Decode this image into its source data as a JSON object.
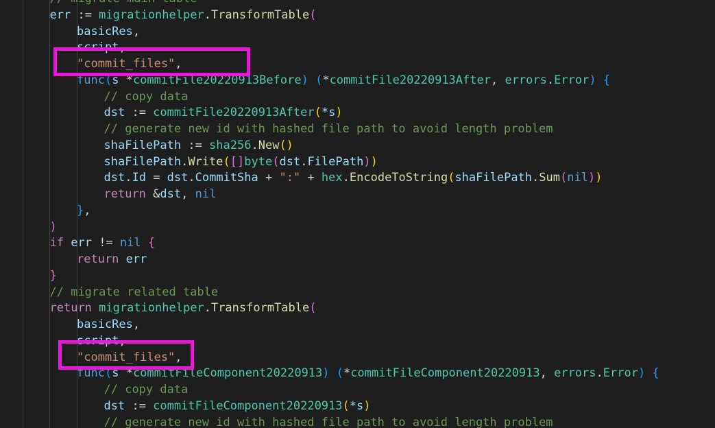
{
  "colors": {
    "background": "#1e1e1e",
    "highlight": "#e817d9",
    "keyword": "#569cd6",
    "control": "#c586c0",
    "identifier": "#9cdcfe",
    "function": "#dcdcaa",
    "type": "#4ec9b0",
    "string": "#ce9178",
    "comment": "#6a9955",
    "plain": "#d4d4d4",
    "bracket1": "#ffd700",
    "bracket2": "#da70d6",
    "bracket3": "#179fff"
  },
  "lines": [
    {
      "indent": 1,
      "tokens": [
        [
          "// migrate main table",
          "comment"
        ]
      ]
    },
    {
      "indent": 1,
      "tokens": [
        [
          "err",
          "identifier"
        ],
        [
          " := ",
          "plain"
        ],
        [
          "migrationhelper",
          "type"
        ],
        [
          ".",
          "plain"
        ],
        [
          "TransformTable",
          "function"
        ],
        [
          "(",
          "bracket2"
        ]
      ]
    },
    {
      "indent": 2,
      "tokens": [
        [
          "basicRes",
          "identifier"
        ],
        [
          ",",
          "plain"
        ]
      ]
    },
    {
      "indent": 2,
      "tokens": [
        [
          "script",
          "identifier"
        ],
        [
          ",",
          "plain"
        ]
      ]
    },
    {
      "indent": 2,
      "tokens": [
        [
          "\"commit_files\"",
          "string"
        ],
        [
          ",",
          "plain"
        ]
      ]
    },
    {
      "indent": 2,
      "tokens": [
        [
          "func",
          "keyword"
        ],
        [
          "(",
          "bracket3"
        ],
        [
          "s ",
          "identifier"
        ],
        [
          "*",
          "plain"
        ],
        [
          "commitFile20220913Before",
          "type"
        ],
        [
          ") ",
          "bracket3"
        ],
        [
          "(",
          "bracket3"
        ],
        [
          "*",
          "plain"
        ],
        [
          "commitFile20220913After",
          "type"
        ],
        [
          ", ",
          "plain"
        ],
        [
          "errors",
          "type"
        ],
        [
          ".",
          "plain"
        ],
        [
          "Error",
          "type"
        ],
        [
          ") ",
          "bracket3"
        ],
        [
          "{",
          "bracket3"
        ]
      ]
    },
    {
      "indent": 3,
      "tokens": [
        [
          "// copy data",
          "comment"
        ]
      ]
    },
    {
      "indent": 3,
      "tokens": [
        [
          "dst",
          "identifier"
        ],
        [
          " := ",
          "plain"
        ],
        [
          "commitFile20220913After",
          "type"
        ],
        [
          "(",
          "bracket1"
        ],
        [
          "*s",
          "identifier"
        ],
        [
          ")",
          "bracket1"
        ]
      ]
    },
    {
      "indent": 3,
      "tokens": [
        [
          "// generate new id with hashed file path to avoid length problem",
          "comment"
        ]
      ]
    },
    {
      "indent": 3,
      "tokens": [
        [
          "shaFilePath",
          "identifier"
        ],
        [
          " := ",
          "plain"
        ],
        [
          "sha256",
          "type"
        ],
        [
          ".",
          "plain"
        ],
        [
          "New",
          "function"
        ],
        [
          "()",
          "bracket1"
        ]
      ]
    },
    {
      "indent": 3,
      "tokens": [
        [
          "shaFilePath",
          "identifier"
        ],
        [
          ".",
          "plain"
        ],
        [
          "Write",
          "function"
        ],
        [
          "(",
          "bracket1"
        ],
        [
          "[]",
          "bracket2"
        ],
        [
          "byte",
          "type"
        ],
        [
          "(",
          "bracket2"
        ],
        [
          "dst",
          "identifier"
        ],
        [
          ".",
          "plain"
        ],
        [
          "FilePath",
          "identifier"
        ],
        [
          ")",
          "bracket2"
        ],
        [
          ")",
          "bracket1"
        ]
      ]
    },
    {
      "indent": 3,
      "tokens": [
        [
          "dst",
          "identifier"
        ],
        [
          ".",
          "plain"
        ],
        [
          "Id",
          "identifier"
        ],
        [
          " = ",
          "plain"
        ],
        [
          "dst",
          "identifier"
        ],
        [
          ".",
          "plain"
        ],
        [
          "CommitSha",
          "identifier"
        ],
        [
          " + ",
          "plain"
        ],
        [
          "\":\"",
          "string"
        ],
        [
          " + ",
          "plain"
        ],
        [
          "hex",
          "type"
        ],
        [
          ".",
          "plain"
        ],
        [
          "EncodeToString",
          "function"
        ],
        [
          "(",
          "bracket1"
        ],
        [
          "shaFilePath",
          "identifier"
        ],
        [
          ".",
          "plain"
        ],
        [
          "Sum",
          "function"
        ],
        [
          "(",
          "bracket2"
        ],
        [
          "nil",
          "keyword"
        ],
        [
          ")",
          "bracket2"
        ],
        [
          ")",
          "bracket1"
        ]
      ]
    },
    {
      "indent": 3,
      "tokens": [
        [
          "return",
          "control"
        ],
        [
          " &",
          "plain"
        ],
        [
          "dst",
          "identifier"
        ],
        [
          ", ",
          "plain"
        ],
        [
          "nil",
          "keyword"
        ]
      ]
    },
    {
      "indent": 2,
      "tokens": [
        [
          "}",
          "bracket3"
        ],
        [
          ",",
          "plain"
        ]
      ]
    },
    {
      "indent": 1,
      "tokens": [
        [
          ")",
          "bracket2"
        ]
      ]
    },
    {
      "indent": 1,
      "tokens": [
        [
          "if",
          "control"
        ],
        [
          " ",
          "plain"
        ],
        [
          "err",
          "identifier"
        ],
        [
          " != ",
          "plain"
        ],
        [
          "nil",
          "keyword"
        ],
        [
          " ",
          "plain"
        ],
        [
          "{",
          "bracket2"
        ]
      ]
    },
    {
      "indent": 2,
      "tokens": [
        [
          "return",
          "control"
        ],
        [
          " ",
          "plain"
        ],
        [
          "err",
          "identifier"
        ]
      ]
    },
    {
      "indent": 1,
      "tokens": [
        [
          "}",
          "bracket2"
        ]
      ]
    },
    {
      "indent": 1,
      "tokens": [
        [
          "// migrate related table",
          "comment"
        ]
      ]
    },
    {
      "indent": 1,
      "tokens": [
        [
          "return",
          "control"
        ],
        [
          " ",
          "plain"
        ],
        [
          "migrationhelper",
          "type"
        ],
        [
          ".",
          "plain"
        ],
        [
          "TransformTable",
          "function"
        ],
        [
          "(",
          "bracket2"
        ]
      ]
    },
    {
      "indent": 2,
      "tokens": [
        [
          "basicRes",
          "identifier"
        ],
        [
          ",",
          "plain"
        ]
      ]
    },
    {
      "indent": 2,
      "tokens": [
        [
          "script",
          "identifier"
        ],
        [
          ",",
          "plain"
        ]
      ]
    },
    {
      "indent": 2,
      "tokens": [
        [
          "\"commit_files\"",
          "string"
        ],
        [
          ",",
          "plain"
        ]
      ]
    },
    {
      "indent": 2,
      "tokens": [
        [
          "func",
          "keyword"
        ],
        [
          "(",
          "bracket3"
        ],
        [
          "s ",
          "identifier"
        ],
        [
          "*",
          "plain"
        ],
        [
          "commitFileComponent20220913",
          "type"
        ],
        [
          ") ",
          "bracket3"
        ],
        [
          "(",
          "bracket3"
        ],
        [
          "*",
          "plain"
        ],
        [
          "commitFileComponent20220913",
          "type"
        ],
        [
          ", ",
          "plain"
        ],
        [
          "errors",
          "type"
        ],
        [
          ".",
          "plain"
        ],
        [
          "Error",
          "type"
        ],
        [
          ") ",
          "bracket3"
        ],
        [
          "{",
          "bracket3"
        ]
      ]
    },
    {
      "indent": 3,
      "tokens": [
        [
          "// copy data",
          "comment"
        ]
      ]
    },
    {
      "indent": 3,
      "tokens": [
        [
          "dst",
          "identifier"
        ],
        [
          " := ",
          "plain"
        ],
        [
          "commitFileComponent20220913",
          "type"
        ],
        [
          "(",
          "bracket1"
        ],
        [
          "*s",
          "identifier"
        ],
        [
          ")",
          "bracket1"
        ]
      ]
    },
    {
      "indent": 3,
      "tokens": [
        [
          "// generate new id with hashed file path to avoid length problem",
          "comment"
        ]
      ]
    }
  ],
  "highlights": [
    4,
    22
  ]
}
